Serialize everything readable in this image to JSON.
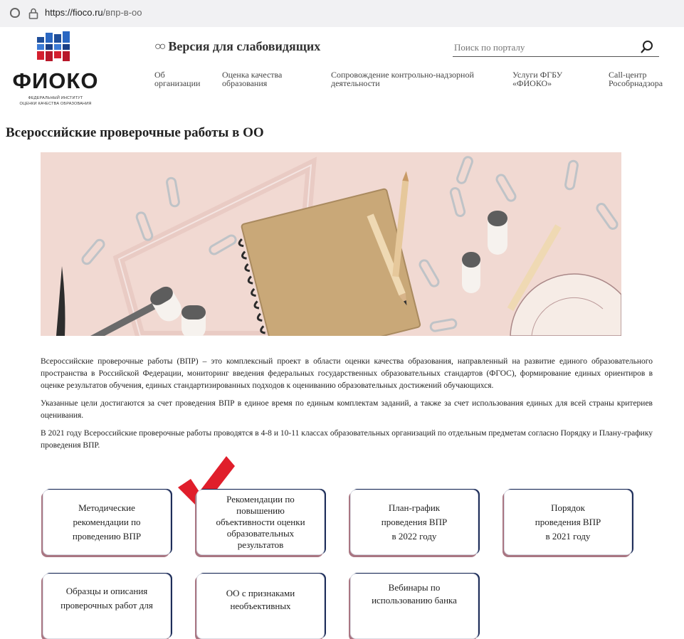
{
  "browser": {
    "url_domain": "https://fioco.ru",
    "url_path": "/впр-в-оо"
  },
  "logo": {
    "name": "ФИОКО",
    "subtitle_1": "ФЕДЕРАЛЬНЫЙ ИНСТИТУТ",
    "subtitle_2": "ОЦЕНКИ КАЧЕСТВА ОБРАЗОВАНИЯ"
  },
  "header": {
    "impaired_version": "Версия для слабовидящих",
    "search_placeholder": "Поиск по порталу"
  },
  "nav": [
    {
      "line1": "Об",
      "line2": "организации"
    },
    {
      "line1": "Оценка качества",
      "line2": "образования"
    },
    {
      "line1": "Сопровождение контрольно-надзорной",
      "line2": "деятельности"
    },
    {
      "line1": "Услуги ФГБУ",
      "line2": "«ФИОКО»"
    },
    {
      "line1": "Call-центр",
      "line2": "Рособрнадзора"
    }
  ],
  "page": {
    "title": "Всероссийские проверочные работы в ОО"
  },
  "paragraphs": [
    "Всероссийские проверочные работы (ВПР) – это комплексный проект в области оценки качества образования, направленный на развитие единого образовательного пространства в Российской Федерации, мониторинг введения федеральных государственных образовательных стандартов (ФГОС), формирование единых ориентиров в оценке результатов обучения, единых стандартизированных подходов к оцениванию образовательных достижений обучающихся.",
    "Указанные цели достигаются за счет проведения ВПР в единое время по единым комплектам заданий, а также за счет использования единых для всей страны критериев оценивания.",
    "В 2021 году Всероссийские проверочные работы проводятся в 4-8 и 10-11 классах образовательных организаций по отдельным предметам согласно Порядку и Плану-графику проведения ВПР."
  ],
  "cards": [
    {
      "lines": [
        "Методические",
        "рекомендации по",
        "проведению ВПР"
      ]
    },
    {
      "lines": [
        "Рекомендации по",
        "повышению",
        "объективности оценки",
        "образовательных",
        "результатов"
      ]
    },
    {
      "lines": [
        "План-график",
        "проведения ВПР",
        "в 2022 году"
      ]
    },
    {
      "lines": [
        "Порядок",
        "проведения ВПР",
        "в 2021 году"
      ]
    },
    {
      "lines": [
        "Образцы и описания",
        "проверочных работ для"
      ]
    },
    {
      "lines": [
        "ОО с признаками",
        "необъективных"
      ]
    },
    {
      "lines": [
        "Вебинары по",
        "использованию банка"
      ]
    }
  ],
  "colors": {
    "accent_red": "#e01e2b",
    "card_shadow_rose": "#a97682",
    "card_shadow_navy": "#1e2e5a"
  }
}
